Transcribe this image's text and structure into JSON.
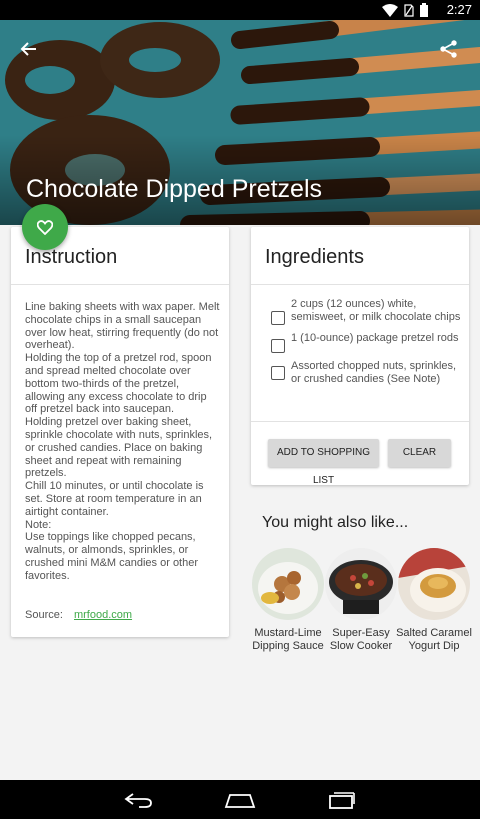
{
  "status_bar": {
    "time": "2:27"
  },
  "recipe": {
    "title": "Chocolate Dipped Pretzels"
  },
  "instruction": {
    "heading": "Instruction",
    "text": "Line baking sheets with wax paper. Melt chocolate chips in a small saucepan over low heat, stirring frequently (do not overheat).\nHolding the top of a pretzel rod, spoon and spread melted chocolate over bottom two-thirds of the pretzel, allowing any excess chocolate to drip off pretzel back into saucepan.\nHolding pretzel over baking sheet, sprinkle chocolate with nuts, sprinkles, or crushed candies. Place on baking sheet and repeat with remaining pretzels.\nChill 10 minutes, or until chocolate is set. Store at room temperature in an airtight container.\nNote:\nUse toppings like chopped pecans, walnuts, or almonds, sprinkles, or crushed mini M&M candies or other favorites.",
    "source_label": "Source:",
    "source_link": "mrfood.com"
  },
  "ingredients": {
    "heading": "Ingredients",
    "items": [
      "2 cups (12 ounces) white, semisweet, or milk chocolate chips",
      "1 (10-ounce) package pretzel rods",
      "Assorted chopped nuts, sprinkles, or crushed candies (See Note)"
    ],
    "add_button": "ADD TO SHOPPING LIST",
    "clear_button": "CLEAR"
  },
  "related": {
    "heading": "You might also like...",
    "items": [
      {
        "name_line1": "Mustard-Lime",
        "name_line2": "Dipping Sauce"
      },
      {
        "name_line1": "Super-Easy",
        "name_line2": "Slow Cooker"
      },
      {
        "name_line1": "Salted Caramel",
        "name_line2": "Yogurt Dip"
      }
    ]
  },
  "icons": {
    "back": "arrow-back-icon",
    "share": "share-icon",
    "favorite": "heart-icon",
    "wifi": "wifi-icon",
    "battery": "battery-icon",
    "nav_back": "nav-back-icon",
    "nav_home": "nav-home-icon",
    "nav_recents": "nav-recents-icon"
  },
  "colors": {
    "accent": "#3fa949",
    "status_bar": "#000000"
  }
}
